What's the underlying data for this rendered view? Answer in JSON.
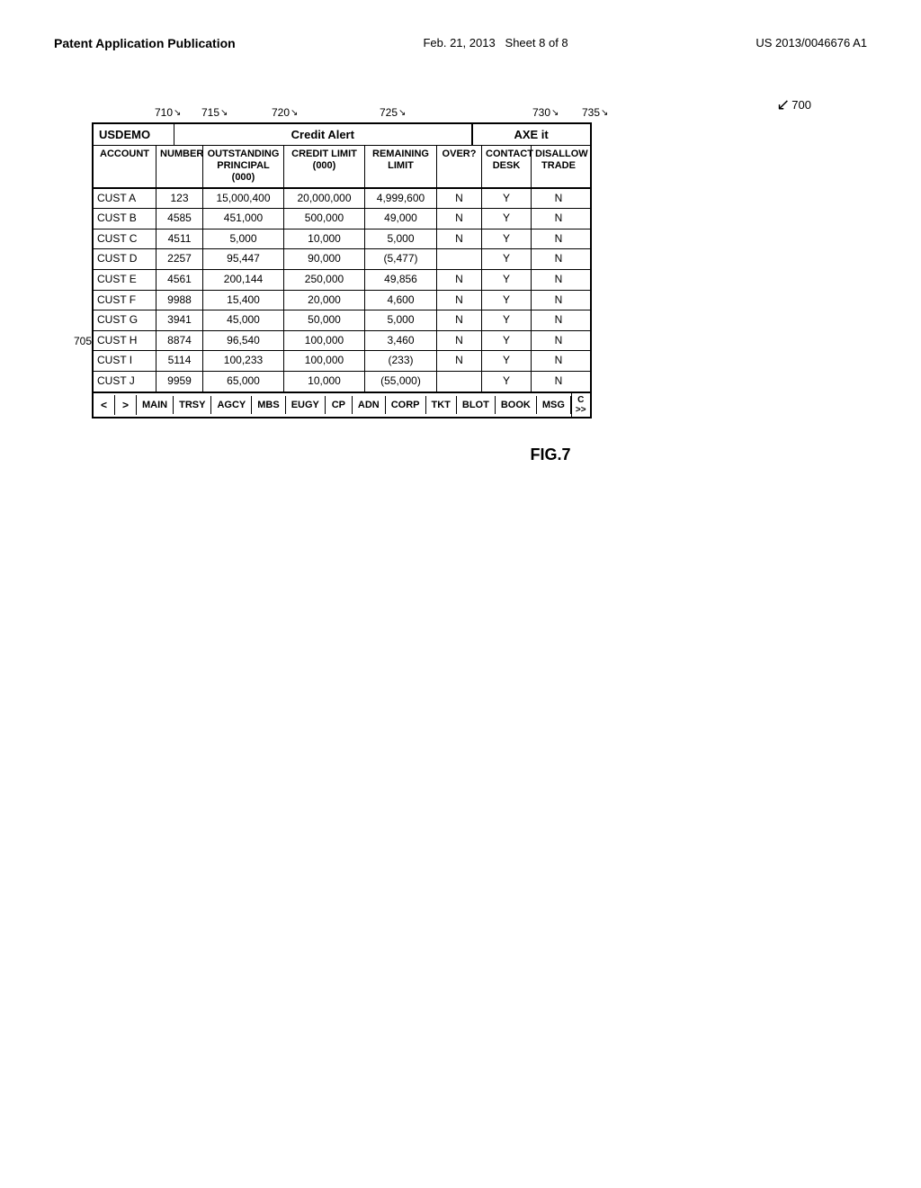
{
  "header": {
    "left": "Patent Application Publication",
    "center_date": "Feb. 21, 2013",
    "center_sheet": "Sheet 8 of 8",
    "right": "US 2013/0046676 A1"
  },
  "ref_numbers": {
    "r700": "700",
    "r705": "705",
    "r710": "710",
    "r715": "715",
    "r720": "720",
    "r725": "725",
    "r730": "730",
    "r735": "735",
    "fig": "FIG.7"
  },
  "sections": {
    "usdemo": "USDEMO",
    "credit_alert": "Credit Alert",
    "axe": "AXE it"
  },
  "col_headers": {
    "account": "ACCOUNT",
    "number": "NUMBER",
    "outstanding": "OUTSTANDING PRINCIPAL (000)",
    "credit_limit": "CREDIT LIMIT (000)",
    "remaining": "REMAINING LIMIT",
    "over": "OVER?",
    "contact": "CONTACT DESK",
    "disallow": "DISALLOW TRADE"
  },
  "rows": [
    {
      "account": "CUST A",
      "number": "123",
      "outstanding": "15,000,400",
      "credit_limit": "20,000,000",
      "remaining": "4,999,600",
      "over": "N",
      "contact": "Y",
      "disallow": "N"
    },
    {
      "account": "CUST B",
      "number": "4585",
      "outstanding": "451,000",
      "credit_limit": "500,000",
      "remaining": "49,000",
      "over": "N",
      "contact": "Y",
      "disallow": "N"
    },
    {
      "account": "CUST C",
      "number": "4511",
      "outstanding": "5,000",
      "credit_limit": "10,000",
      "remaining": "5,000",
      "over": "N",
      "contact": "Y",
      "disallow": "N"
    },
    {
      "account": "CUST D",
      "number": "2257",
      "outstanding": "95,447",
      "credit_limit": "90,000",
      "remaining": "(5,477)",
      "over": "",
      "contact": "Y",
      "disallow": "N"
    },
    {
      "account": "CUST E",
      "number": "4561",
      "outstanding": "200,144",
      "credit_limit": "250,000",
      "remaining": "49,856",
      "over": "N",
      "contact": "Y",
      "disallow": "N"
    },
    {
      "account": "CUST F",
      "number": "9988",
      "outstanding": "15,400",
      "credit_limit": "20,000",
      "remaining": "4,600",
      "over": "N",
      "contact": "Y",
      "disallow": "N"
    },
    {
      "account": "CUST G",
      "number": "3941",
      "outstanding": "45,000",
      "credit_limit": "50,000",
      "remaining": "5,000",
      "over": "N",
      "contact": "Y",
      "disallow": "N"
    },
    {
      "account": "CUST H",
      "number": "8874",
      "outstanding": "96,540",
      "credit_limit": "100,000",
      "remaining": "3,460",
      "over": "N",
      "contact": "Y",
      "disallow": "N"
    },
    {
      "account": "CUST I",
      "number": "5114",
      "outstanding": "100,233",
      "credit_limit": "100,000",
      "remaining": "(233)",
      "over": "N",
      "contact": "Y",
      "disallow": "N"
    },
    {
      "account": "CUST J",
      "number": "9959",
      "outstanding": "65,000",
      "credit_limit": "10,000",
      "remaining": "(55,000)",
      "over": "",
      "contact": "Y",
      "disallow": "N"
    }
  ],
  "bottom_buttons": {
    "left_arrow": "<",
    "right_arrow": ">",
    "main": "MAIN",
    "trsy": "TRSY",
    "agcy": "AGCY",
    "mbs": "MBS",
    "eugy": "EUGY",
    "cp": "CP",
    "adn": "ADN",
    "corp": "CORP",
    "tkt": "TKT",
    "blot": "BLOT",
    "book": "BOOK",
    "msg": "MSG",
    "c": "C",
    "double_right": ">>"
  }
}
